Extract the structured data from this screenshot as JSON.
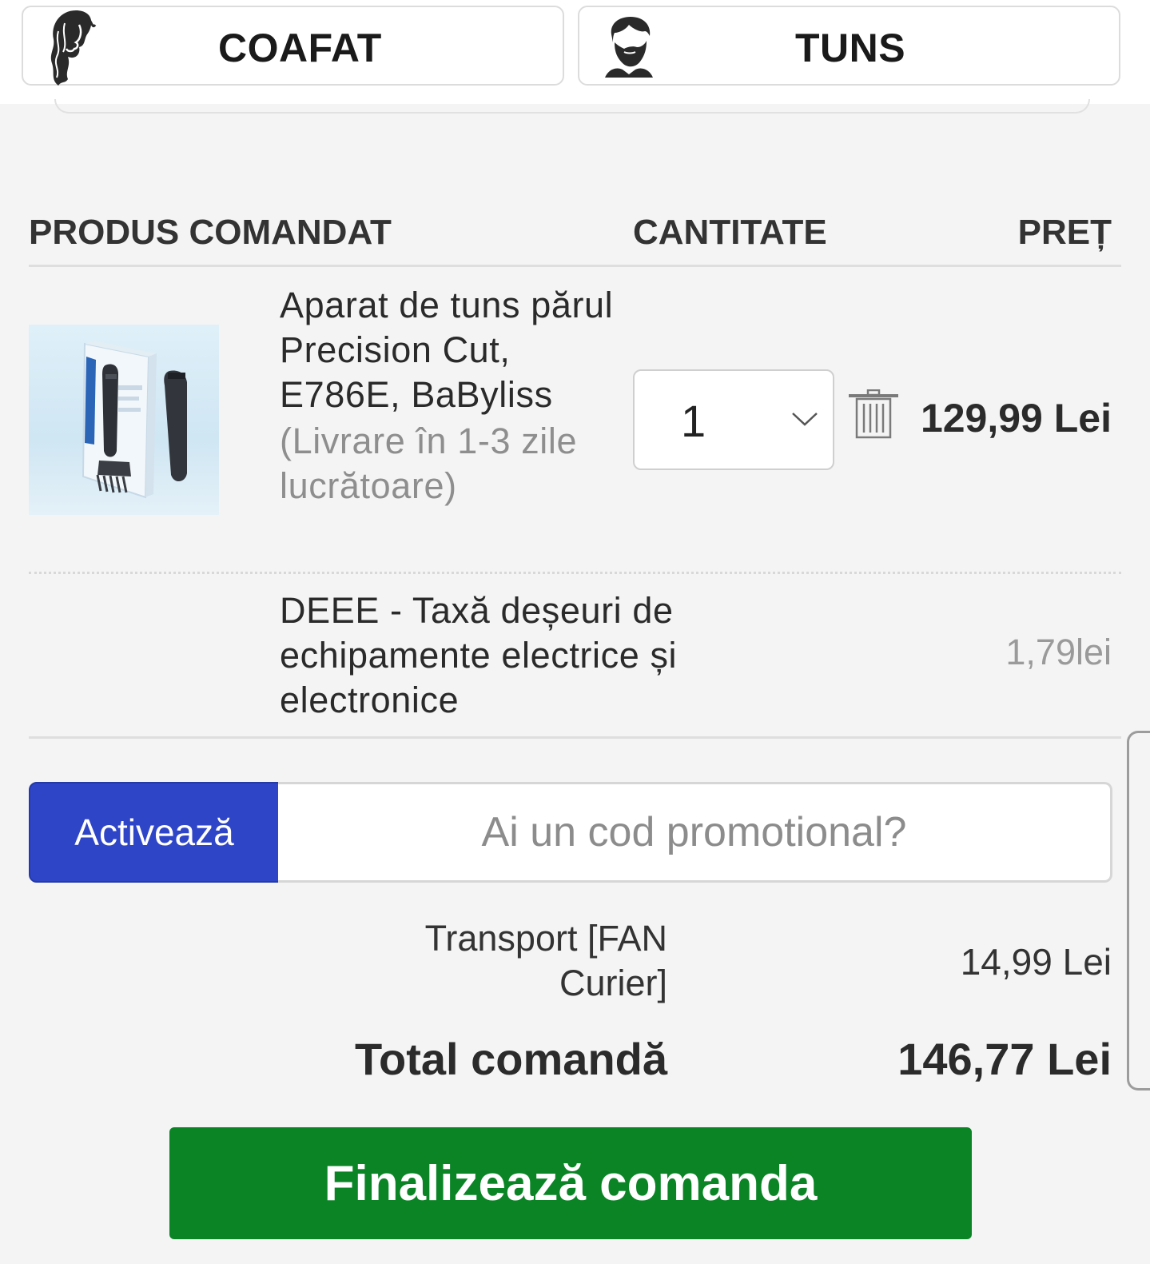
{
  "categories": [
    {
      "label": "COAFAT",
      "icon": "woman-hair-icon"
    },
    {
      "label": "TUNS",
      "icon": "bearded-man-icon"
    }
  ],
  "table_headers": {
    "product": "PRODUS COMANDAT",
    "quantity": "CANTITATE",
    "price": "PREȚ"
  },
  "item": {
    "name": "Aparat de tuns părul Precision Cut, E786E, BaByliss",
    "delivery": "(Livrare în 1-3 zile lucrătoare)",
    "quantity": "1",
    "price": "129,99 Lei"
  },
  "fee": {
    "name": "DEEE - Taxă deșeuri de echipamente electrice și electronice",
    "price": "1,79lei"
  },
  "promo": {
    "button_label": "Activează",
    "placeholder": "Ai un cod promotional?",
    "button_color": "#2f45c8"
  },
  "summary": {
    "transport_label": "Transport [FAN Curier]",
    "transport_price": "14,99 Lei",
    "total_label": "Total comandă",
    "total_price": "146,77 Lei"
  },
  "finalize": {
    "label": "Finalizează comanda",
    "color": "#0b8426"
  }
}
